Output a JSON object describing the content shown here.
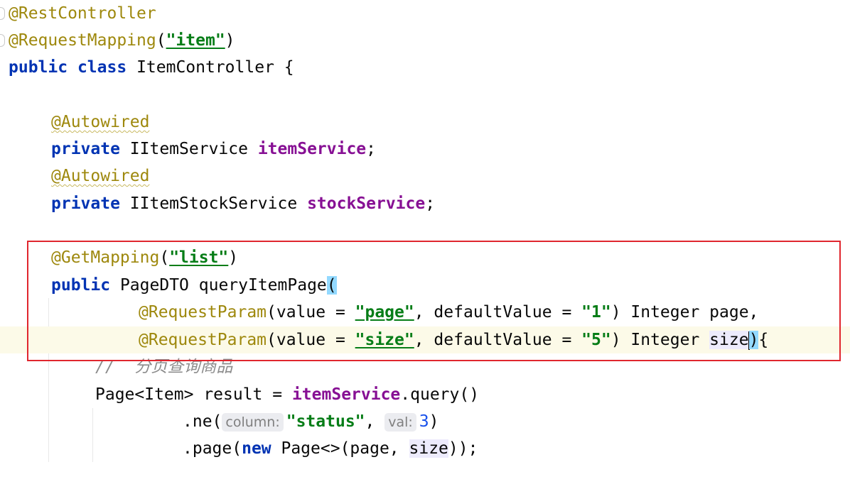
{
  "editor": {
    "language": "java",
    "lines": [
      {
        "annotation": "@RestController"
      },
      {
        "annotation": "@RequestMapping",
        "open": "(",
        "value": "\"item\"",
        "close": ")"
      },
      {
        "kw1": "public",
        "kw2": "class",
        "name": "ItemController {"
      },
      {},
      {
        "annotation": "@Autowired"
      },
      {
        "kw": "private",
        "type": "IItemService",
        "field": "itemService",
        "end": ";"
      },
      {
        "annotation": "@Autowired"
      },
      {
        "kw": "private",
        "type": "IItemStockService",
        "field": "stockService",
        "end": ";"
      },
      {},
      {
        "annotation": "@GetMapping",
        "open": "(",
        "value": "\"list\"",
        "close": ")"
      },
      {
        "kw": "public",
        "type": "PageDTO",
        "method": "queryItemPage",
        "open": "("
      },
      {
        "annotation": "@RequestParam",
        "pre": "(value = ",
        "value": "\"page\"",
        "mid": ", defaultValue = ",
        "default": "\"1\"",
        "post": ") Integer page,"
      },
      {
        "annotation": "@RequestParam",
        "pre": "(value = ",
        "value": "\"size\"",
        "mid": ", defaultValue = ",
        "default": "\"5\"",
        "post1": ") Integer ",
        "param": "size",
        "close": ")",
        "brace": "{"
      },
      {
        "comment": "//  分页查询商品"
      },
      {
        "type": "Page<Item> result = ",
        "field": "itemService",
        "rest": ".query()"
      },
      {
        "pre": ".ne(",
        "hint1": "column:",
        "value": "\"status\"",
        "comma": ", ",
        "hint2": "val:",
        "num": "3",
        "close": ")"
      },
      {
        "pre": ".page(",
        "kw": "new",
        "mid": " Page<>(page, ",
        "param": "size",
        "close": "));"
      }
    ]
  },
  "colors": {
    "keyword": "#0033b3",
    "annotation": "#9e880d",
    "string": "#067d17",
    "field": "#871094",
    "comment": "#8c8c8c",
    "number": "#1750eb",
    "selection_box": "#e0262e"
  }
}
